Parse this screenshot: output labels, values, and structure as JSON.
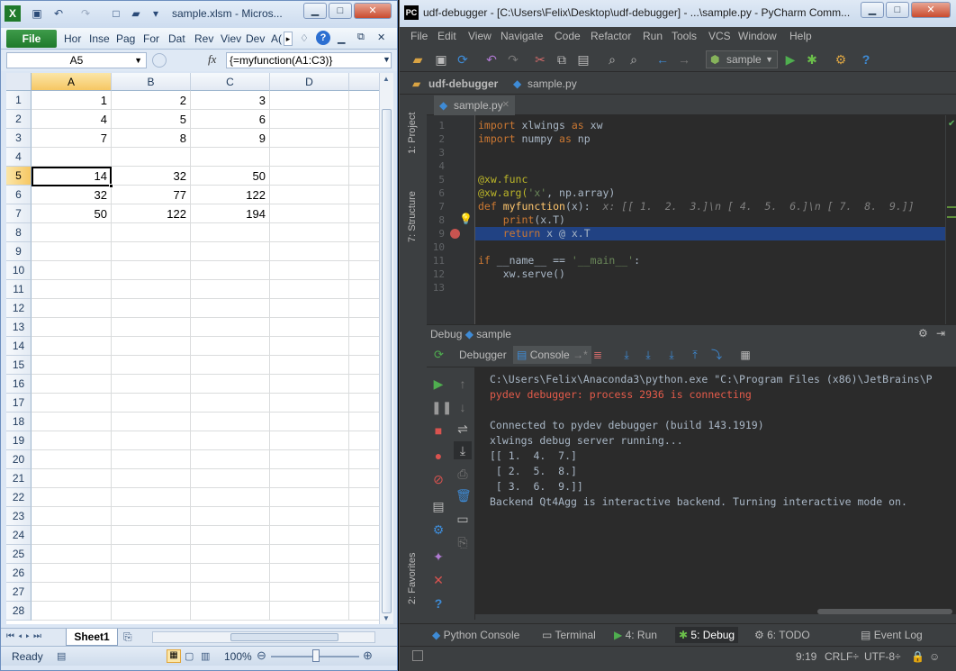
{
  "excel": {
    "title": "sample.xlsm - Micros...",
    "ribbon_file": "File",
    "ribbon_tabs": [
      "Hor",
      "Inse",
      "Pag",
      "For",
      "Dat",
      "Rev",
      "Viev",
      "Dev",
      "A("
    ],
    "namebox": "A5",
    "fx_label": "fx",
    "formula": "{=myfunction(A1:C3)}",
    "columns": [
      "A",
      "B",
      "C",
      "D"
    ],
    "rows": [
      "1",
      "2",
      "3",
      "4",
      "5",
      "6",
      "7",
      "8",
      "9",
      "10",
      "11",
      "12",
      "13",
      "14",
      "15",
      "16",
      "17",
      "18",
      "19",
      "20",
      "21",
      "22",
      "23",
      "24",
      "25",
      "26",
      "27",
      "28"
    ],
    "cells": [
      [
        "1",
        "2",
        "3"
      ],
      [
        "4",
        "5",
        "6"
      ],
      [
        "7",
        "8",
        "9"
      ],
      [
        "",
        "",
        ""
      ],
      [
        "14",
        "32",
        "50"
      ],
      [
        "32",
        "77",
        "122"
      ],
      [
        "50",
        "122",
        "194"
      ]
    ],
    "sheet_tab": "Sheet1",
    "status_ready": "Ready",
    "zoom": "100%"
  },
  "pycharm": {
    "title": "udf-debugger - [C:\\Users\\Felix\\Desktop\\udf-debugger] - ...\\sample.py - PyCharm Comm...",
    "menu": [
      "File",
      "Edit",
      "View",
      "Navigate",
      "Code",
      "Refactor",
      "Run",
      "Tools",
      "VCS",
      "Window",
      "Help"
    ],
    "run_config": "sample",
    "nav_project": "udf-debugger",
    "nav_file": "sample.py",
    "editor_tab": "sample.py",
    "left_tabs": [
      "1: Project",
      "7: Structure",
      "2: Favorites"
    ],
    "line_numbers": [
      "1",
      "2",
      "3",
      "4",
      "5",
      "6",
      "7",
      "8",
      "9",
      "10",
      "11",
      "12",
      "13"
    ],
    "code": {
      "l1_kw": "import",
      "l1_rest": " xlwings ",
      "l1_kw2": "as",
      "l1_rest2": " xw",
      "l2_kw": "import",
      "l2_rest": " numpy ",
      "l2_kw2": "as",
      "l2_rest2": " np",
      "l5": "@xw.func",
      "l6_deco": "@xw.arg(",
      "l6_str": "'x'",
      "l6_rest": ", np.array)",
      "l7_kw": "def",
      "l7_fn": " myfunction",
      "l7_rest": "(x):",
      "l7_hint": "x: [[ 1.  2.  3.]\\n [ 4.  5.  6.]\\n [ 7.  8.  9.]]",
      "l8_kw": "print",
      "l8_rest": "(x.T)",
      "l9_kw": "return",
      "l9_rest": " x @ x.T",
      "l11_kw": "if",
      "l11_rest": " __name__ == ",
      "l11_str": "'__main__'",
      "l11_end": ":",
      "l12": "xw.serve()"
    },
    "debug_header": "Debug",
    "debug_session": "sample",
    "debug_tabs": {
      "debugger": "Debugger",
      "console": "Console"
    },
    "console_lines": [
      "C:\\Users\\Felix\\Anaconda3\\python.exe \"C:\\Program Files (x86)\\JetBrains\\P",
      "pydev debugger: process 2936 is connecting",
      "",
      "Connected to pydev debugger (build 143.1919)",
      "xlwings debug server running...",
      "[[ 1.  4.  7.]",
      " [ 2.  5.  8.]",
      " [ 3.  6.  9.]]",
      "Backend Qt4Agg is interactive backend. Turning interactive mode on."
    ],
    "bottom_tools": {
      "python_console": "Python Console",
      "terminal": "Terminal",
      "run": "4: Run",
      "debug": "5: Debug",
      "todo": "6: TODO",
      "event_log": "Event Log"
    },
    "status": {
      "position": "9:19",
      "line_sep": "CRLF÷",
      "encoding": "UTF-8÷"
    }
  }
}
